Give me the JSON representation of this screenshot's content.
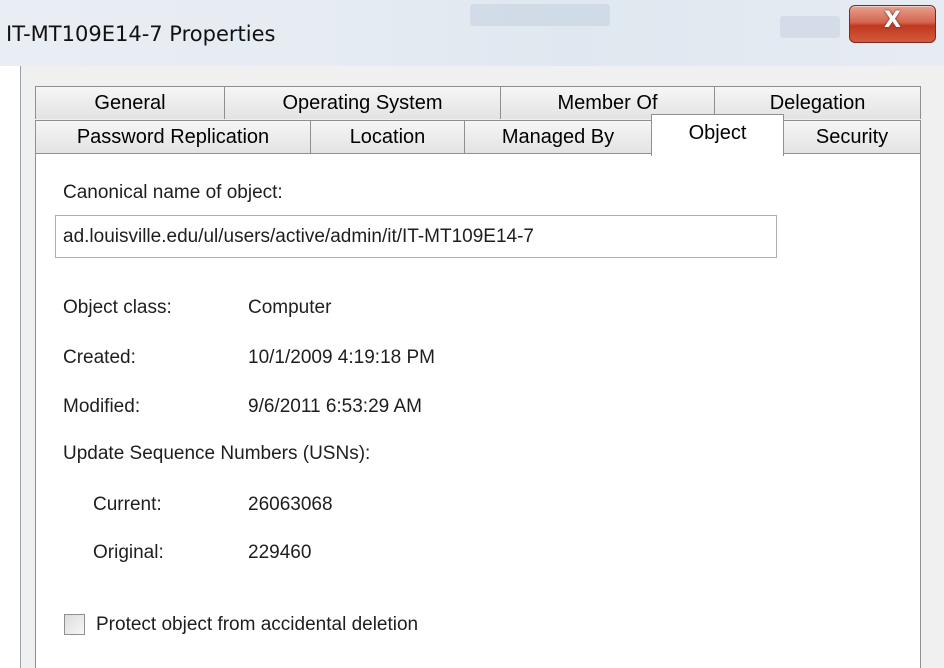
{
  "window": {
    "title": "IT-MT109E14-7 Properties",
    "close_glyph": "X"
  },
  "tabs_row1": [
    {
      "label": "General"
    },
    {
      "label": "Operating System"
    },
    {
      "label": "Member Of"
    },
    {
      "label": "Delegation"
    }
  ],
  "tabs_row2": [
    {
      "label": "Password Replication"
    },
    {
      "label": "Location"
    },
    {
      "label": "Managed By"
    },
    {
      "label": "Object",
      "active": true
    },
    {
      "label": "Security"
    }
  ],
  "object": {
    "canonical_label": "Canonical name of object:",
    "canonical_value": "ad.louisville.edu/ul/users/active/admin/it/IT-MT109E14-7",
    "class_label": "Object class:",
    "class_value": "Computer",
    "created_label": "Created:",
    "created_value": "10/1/2009 4:19:18 PM",
    "modified_label": "Modified:",
    "modified_value": "9/6/2011 6:53:29 AM",
    "usn_label": "Update Sequence Numbers (USNs):",
    "current_label": "Current:",
    "current_value": "26063068",
    "original_label": "Original:",
    "original_value": "229460",
    "protect_label": "Protect object from accidental deletion",
    "protect_checked": false
  }
}
